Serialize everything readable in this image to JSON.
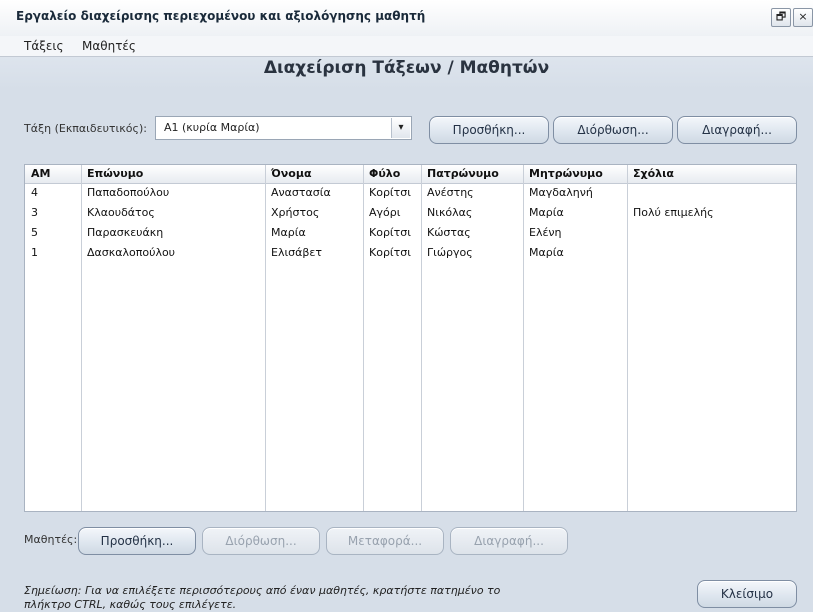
{
  "window": {
    "title": "Εργαλείο διαχείρισης περιεχομένου και αξιολόγησης μαθητή",
    "restore_glyph": "🗗",
    "close_glyph": "×"
  },
  "menu": [
    "Τάξεις",
    "Μαθητές"
  ],
  "heading": "Διαχείριση Τάξεων / Μαθητών",
  "class_section": {
    "label": "Τάξη (Εκπαιδευτικός):",
    "selected": "Α1  (κυρία Μαρία)",
    "dropdown_glyph": "▾",
    "buttons": {
      "add": "Προσθήκη...",
      "edit": "Διόρθωση...",
      "delete": "Διαγραφή..."
    }
  },
  "table": {
    "columns": [
      "AM",
      "Επώνυμο",
      "Όνομα",
      "Φύλο",
      "Πατρώνυμο",
      "Μητρώνυμο",
      "Σχόλια"
    ],
    "rows": [
      [
        "4",
        "Παπαδοπούλου",
        "Αναστασία",
        "Κορίτσι",
        "Ανέστης",
        "Μαγδαληνή",
        ""
      ],
      [
        "3",
        "Κλαουδάτος",
        "Χρήστος",
        "Αγόρι",
        "Νικόλας",
        "Μαρία",
        "Πολύ επιμελής"
      ],
      [
        "5",
        "Παρασκευάκη",
        "Μαρία",
        "Κορίτσι",
        "Κώστας",
        "Ελένη",
        ""
      ],
      [
        "1",
        "Δασκαλοπούλου",
        "Ελισάβετ",
        "Κορίτσι",
        "Γιώργος",
        "Μαρία",
        ""
      ]
    ]
  },
  "students_section": {
    "label": "Μαθητές:",
    "buttons": {
      "add": "Προσθήκη...",
      "edit": "Διόρθωση...",
      "move": "Μεταφορά...",
      "delete": "Διαγραφή..."
    }
  },
  "note": "Σημείωση: Για να επιλέξετε περισσότερους από έναν μαθητές, κρατήστε πατημένο το πλήκτρο CTRL, καθώς τους επιλέγετε.",
  "close_button": "Κλείσιμο"
}
